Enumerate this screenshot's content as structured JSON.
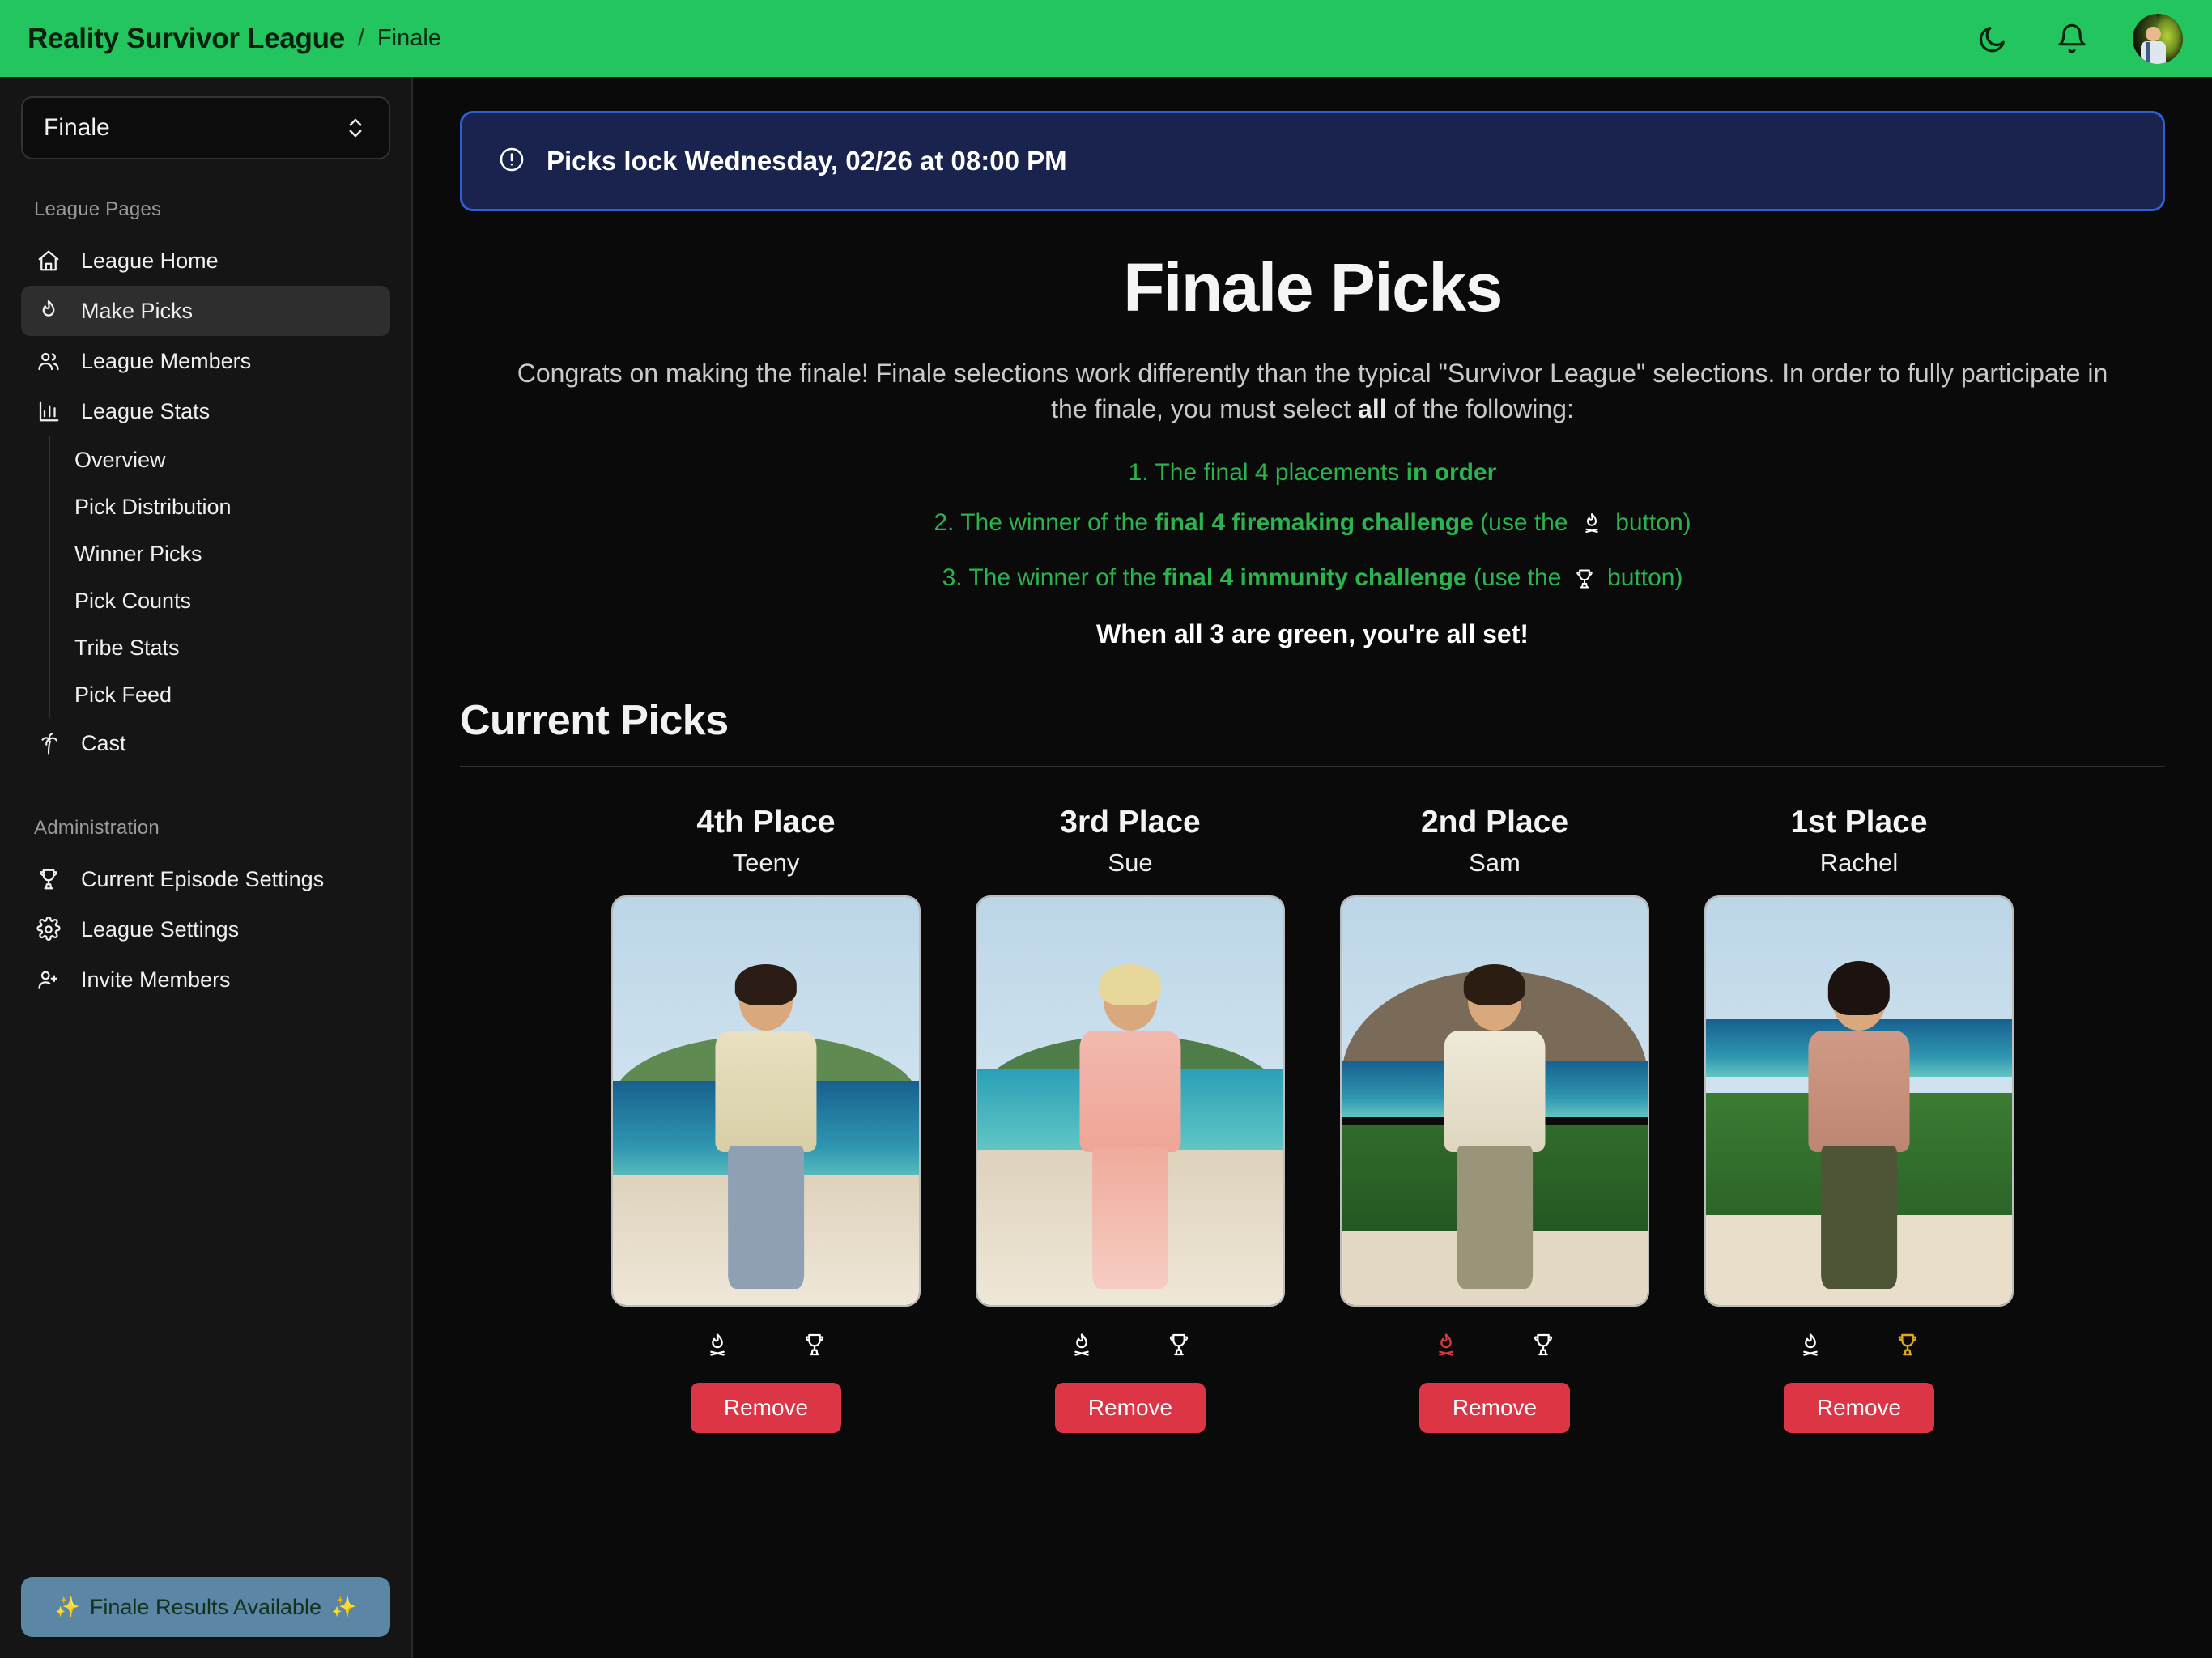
{
  "header": {
    "brand": "Reality Survivor League",
    "separator": "/",
    "breadcrumb": "Finale",
    "theme_toggle_icon": "moon-icon",
    "notifications_icon": "bell-icon",
    "avatar_label": "user-avatar",
    "background_color": "#22c55e"
  },
  "sidebar": {
    "league_selector": {
      "value": "Finale",
      "icon": "chevron-up-down-icon"
    },
    "sections": [
      {
        "title": "League Pages",
        "items": [
          {
            "label": "League Home",
            "icon": "home-icon",
            "active": false
          },
          {
            "label": "Make Picks",
            "icon": "flame-icon",
            "active": true
          },
          {
            "label": "League Members",
            "icon": "users-icon",
            "active": false
          },
          {
            "label": "League Stats",
            "icon": "bar-chart-icon",
            "active": false
          }
        ],
        "subitems": [
          {
            "label": "Overview"
          },
          {
            "label": "Pick Distribution"
          },
          {
            "label": "Winner Picks"
          },
          {
            "label": "Pick Counts"
          },
          {
            "label": "Tribe Stats"
          },
          {
            "label": "Pick Feed"
          }
        ],
        "trailing_items": [
          {
            "label": "Cast",
            "icon": "palm-tree-icon"
          }
        ]
      },
      {
        "title": "Administration",
        "items": [
          {
            "label": "Current Episode Settings",
            "icon": "trophy-icon"
          },
          {
            "label": "League Settings",
            "icon": "gear-icon"
          },
          {
            "label": "Invite Members",
            "icon": "user-plus-icon"
          }
        ]
      }
    ],
    "footer_button": {
      "label": "Finale Results Available",
      "left_icon": "sparkles-emoji",
      "right_icon": "sparkles-emoji",
      "background_color": "#5b86a6",
      "text_color": "#12321c"
    }
  },
  "main": {
    "alert": {
      "icon": "alert-circle-icon",
      "text": "Picks lock Wednesday, 02/26 at 08:00 PM",
      "border_color": "#2f5fd0",
      "background_color": "#19234d"
    },
    "page_title": "Finale Picks",
    "intro_paragraph_part1": "Congrats on making the finale! Finale selections work differently than the typical \"Survivor League\" selections. In order to fully participate in the finale, you must select ",
    "intro_paragraph_bold": "all",
    "intro_paragraph_part2": " of the following:",
    "requirements": [
      {
        "number": "1.",
        "text_before": " The final 4 placements ",
        "bold": "in order",
        "text_after": "",
        "icon": "",
        "text_end": ""
      },
      {
        "number": "2.",
        "text_before": " The winner of the ",
        "bold": "final 4 firemaking challenge",
        "text_after": " (use the ",
        "icon": "campfire-icon",
        "text_end": " button)"
      },
      {
        "number": "3.",
        "text_before": " The winner of the ",
        "bold": "final 4 immunity challenge",
        "text_after": " (use the ",
        "icon": "trophy-icon",
        "text_end": " button)"
      }
    ],
    "all_set_text": "When all 3 are green, you're all set!",
    "requirement_color": "#2ab34f",
    "section_heading": "Current Picks",
    "picks": [
      {
        "place": "4th Place",
        "name": "Teeny",
        "firemaking_icon": "campfire-icon",
        "firemaking_selected": false,
        "immunity_icon": "trophy-icon",
        "immunity_selected": false,
        "remove_label": "Remove"
      },
      {
        "place": "3rd Place",
        "name": "Sue",
        "firemaking_icon": "campfire-icon",
        "firemaking_selected": false,
        "immunity_icon": "trophy-icon",
        "immunity_selected": false,
        "remove_label": "Remove"
      },
      {
        "place": "2nd Place",
        "name": "Sam",
        "firemaking_icon": "campfire-icon",
        "firemaking_selected": true,
        "immunity_icon": "trophy-icon",
        "immunity_selected": false,
        "remove_label": "Remove"
      },
      {
        "place": "1st Place",
        "name": "Rachel",
        "firemaking_icon": "campfire-icon",
        "firemaking_selected": false,
        "immunity_icon": "trophy-icon",
        "immunity_selected": true,
        "remove_label": "Remove"
      }
    ],
    "selected_fire_color": "#d73a3a",
    "selected_trophy_color": "#e0a81c",
    "remove_button_color": "#dc3545"
  }
}
